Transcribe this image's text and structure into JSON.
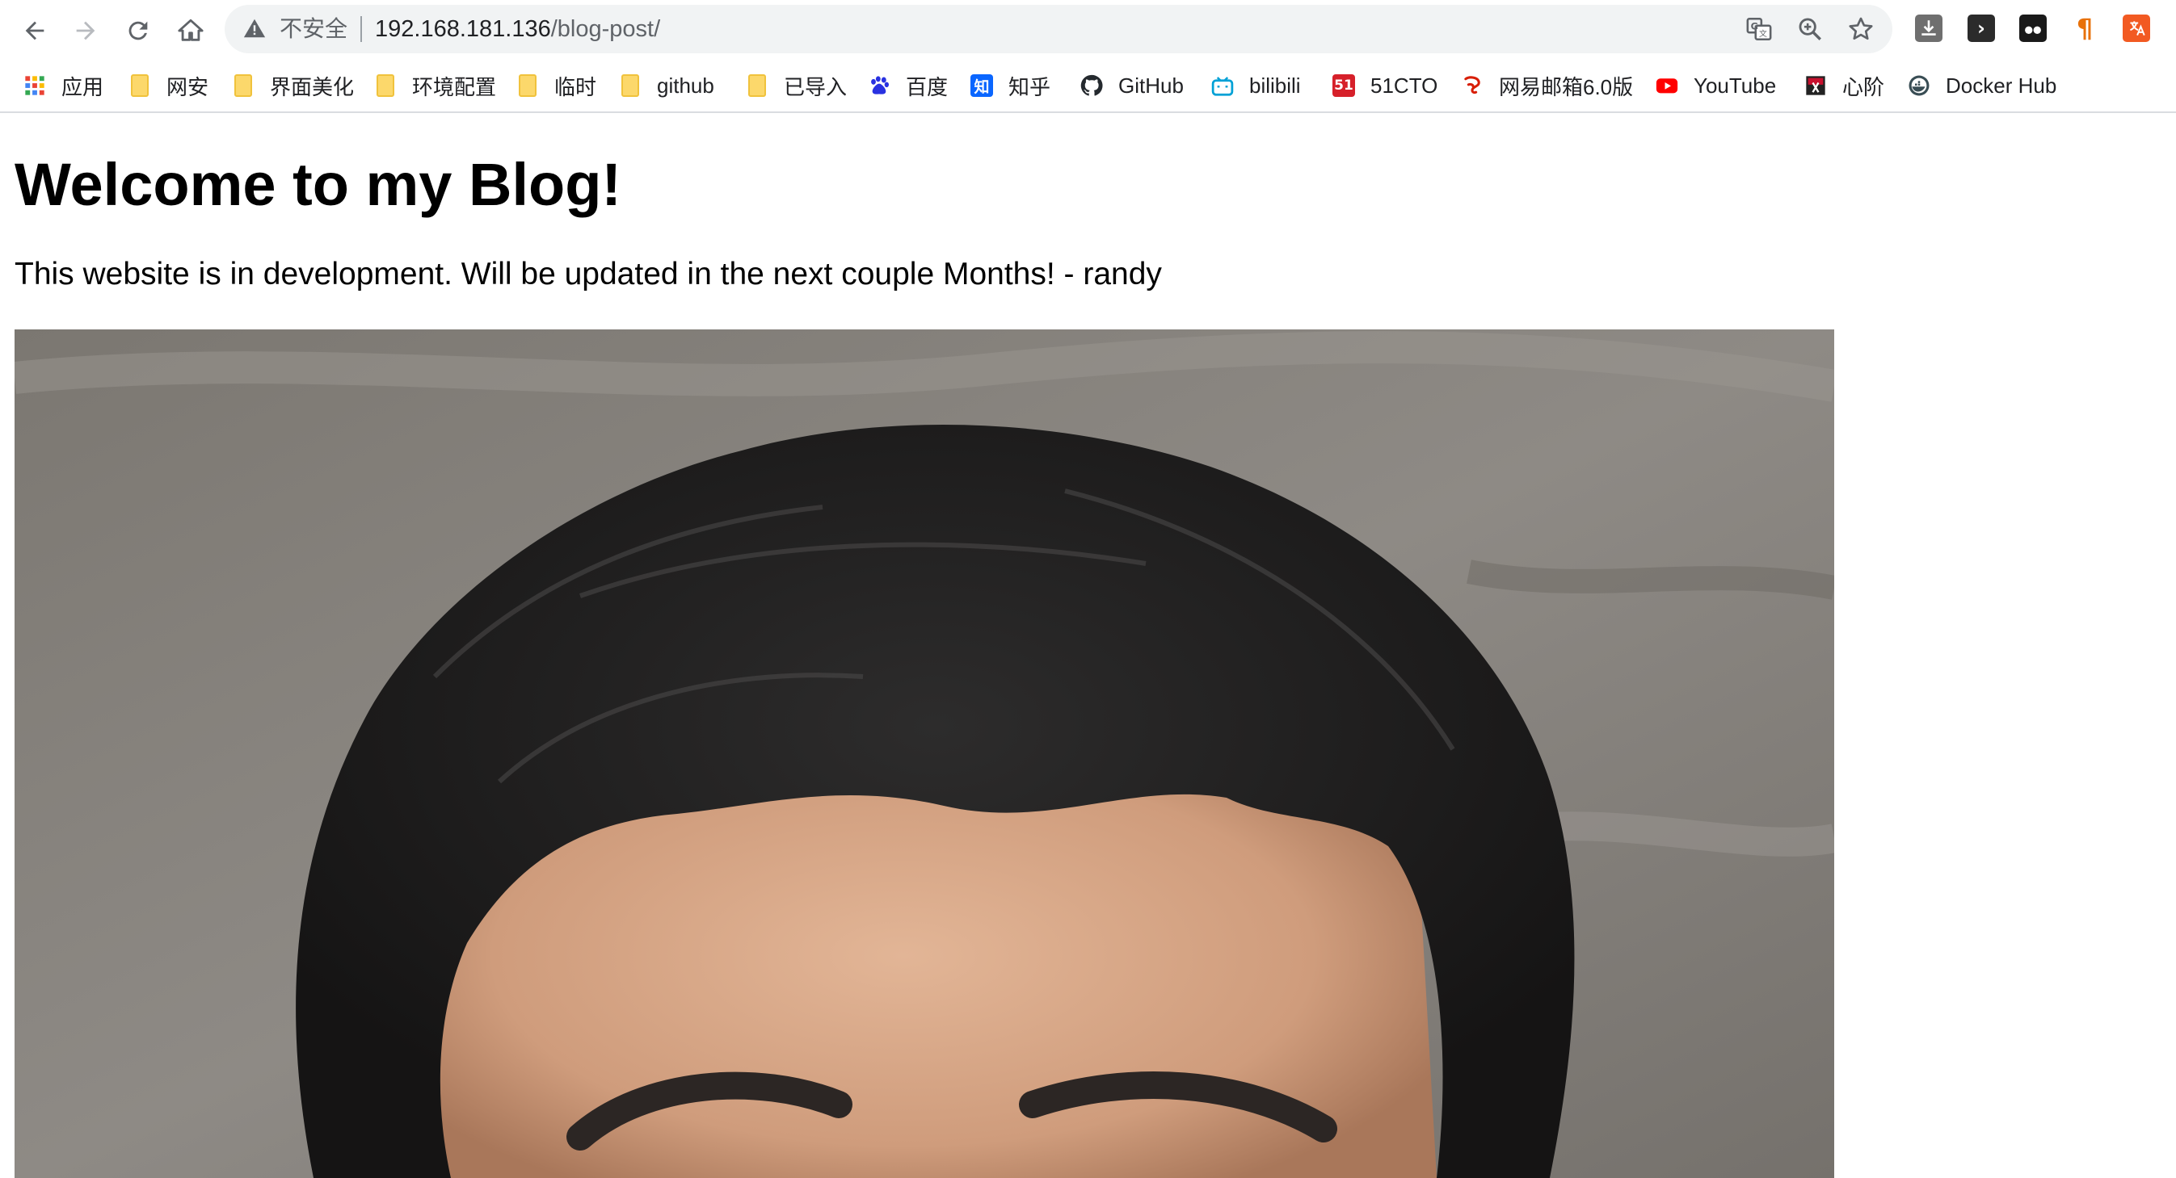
{
  "toolbar": {
    "security_label": "不安全",
    "url_host": "192.168.181.136",
    "url_path": "/blog-post/",
    "extension_labels": [
      "›",
      "¶"
    ]
  },
  "bookmarks": [
    {
      "label": "应用",
      "icon": "apps-grid-icon"
    },
    {
      "label": "网安",
      "icon": "folder-icon"
    },
    {
      "label": "界面美化",
      "icon": "folder-icon"
    },
    {
      "label": "环境配置",
      "icon": "folder-icon"
    },
    {
      "label": "临时",
      "icon": "folder-icon"
    },
    {
      "label": "github",
      "icon": "folder-icon"
    },
    {
      "label": "已导入",
      "icon": "folder-icon"
    },
    {
      "label": "百度",
      "icon": "baidu-icon"
    },
    {
      "label": "知乎",
      "icon": "zhihu-icon",
      "glyph": "知"
    },
    {
      "label": "GitHub",
      "icon": "github-icon"
    },
    {
      "label": "bilibili",
      "icon": "bilibili-icon"
    },
    {
      "label": "51CTO",
      "icon": "51cto-icon",
      "glyph": "51"
    },
    {
      "label": "网易邮箱6.0版",
      "icon": "netease-mail-icon"
    },
    {
      "label": "YouTube",
      "icon": "youtube-icon"
    },
    {
      "label": "心阶",
      "icon": "xinjie-icon"
    },
    {
      "label": "Docker Hub",
      "icon": "docker-hub-icon"
    }
  ],
  "page": {
    "heading": "Welcome to my Blog!",
    "paragraph": "This website is in development. Will be updated in the next couple Months! - randy"
  },
  "colors": {
    "zhihu": "#0a66ff",
    "cto51": "#d6202a",
    "youtube": "#ff0000",
    "bilibili": "#00a1d6"
  }
}
